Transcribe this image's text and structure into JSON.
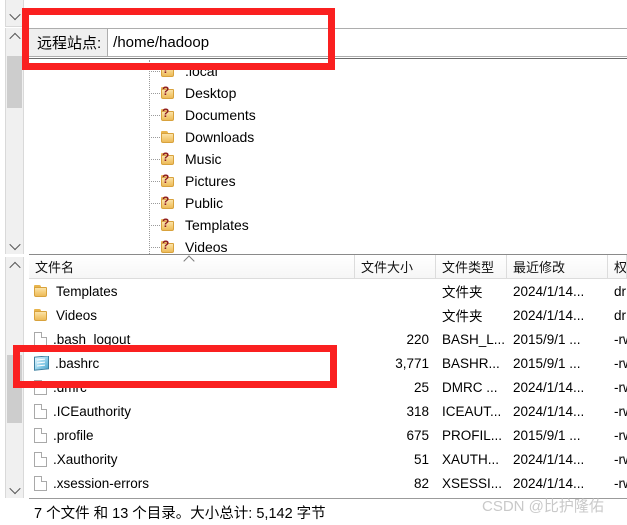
{
  "app": {
    "kind": "filezilla-remote-pane"
  },
  "path_bar": {
    "label": "远程站点:",
    "value": "/home/hadoop"
  },
  "tree": {
    "items": [
      {
        "label": ".local",
        "icon": "folder-unknown-icon",
        "unknown": true,
        "clipped": true
      },
      {
        "label": "Desktop",
        "icon": "folder-unknown-icon",
        "unknown": true
      },
      {
        "label": "Documents",
        "icon": "folder-unknown-icon",
        "unknown": true
      },
      {
        "label": "Downloads",
        "icon": "folder-icon",
        "unknown": false
      },
      {
        "label": "Music",
        "icon": "folder-unknown-icon",
        "unknown": true
      },
      {
        "label": "Pictures",
        "icon": "folder-unknown-icon",
        "unknown": true
      },
      {
        "label": "Public",
        "icon": "folder-unknown-icon",
        "unknown": true
      },
      {
        "label": "Templates",
        "icon": "folder-unknown-icon",
        "unknown": true
      },
      {
        "label": "Videos",
        "icon": "folder-unknown-icon",
        "unknown": true
      }
    ]
  },
  "file_list": {
    "columns": {
      "name": "文件名",
      "size": "文件大小",
      "type": "文件类型",
      "modified": "最近修改",
      "permissions": "权"
    },
    "sort": "name-ascending",
    "rows": [
      {
        "name": "Templates",
        "icon": "folder-icon",
        "size": "",
        "type": "文件夹",
        "modified": "2024/1/14...",
        "permissions": "dr"
      },
      {
        "name": "Videos",
        "icon": "folder-icon",
        "size": "",
        "type": "文件夹",
        "modified": "2024/1/14...",
        "permissions": "dr"
      },
      {
        "name": ".bash_logout",
        "icon": "file-icon",
        "size": "220",
        "type": "BASH_L...",
        "modified": "2015/9/1 ...",
        "permissions": "-rw"
      },
      {
        "name": ".bashrc",
        "icon": "bashrc-icon",
        "size": "3,771",
        "type": "BASHR...",
        "modified": "2015/9/1 ...",
        "permissions": "-rw"
      },
      {
        "name": ".dmrc",
        "icon": "file-icon",
        "size": "25",
        "type": "DMRC ...",
        "modified": "2024/1/14...",
        "permissions": "-rw"
      },
      {
        "name": ".ICEauthority",
        "icon": "file-icon",
        "size": "318",
        "type": "ICEAUT...",
        "modified": "2024/1/14...",
        "permissions": "-rw"
      },
      {
        "name": ".profile",
        "icon": "file-icon",
        "size": "675",
        "type": "PROFIL...",
        "modified": "2015/9/1 ...",
        "permissions": "-rw"
      },
      {
        "name": ".Xauthority",
        "icon": "file-icon",
        "size": "51",
        "type": "XAUTH...",
        "modified": "2024/1/14...",
        "permissions": "-rw"
      },
      {
        "name": ".xsession-errors",
        "icon": "file-icon",
        "size": "82",
        "type": "XSESSI...",
        "modified": "2024/1/14...",
        "permissions": "-rw"
      }
    ]
  },
  "status_bar": {
    "text": "7 个文件 和 13 个目录。大小总计: 5,142 字节"
  },
  "watermark": {
    "text": "CSDN @比护隆佑"
  },
  "annotations": {
    "highlight_color": "#fa2020",
    "boxes": [
      {
        "target": "remote-site-path-bar"
      },
      {
        "target": "bashrc-row"
      }
    ]
  }
}
